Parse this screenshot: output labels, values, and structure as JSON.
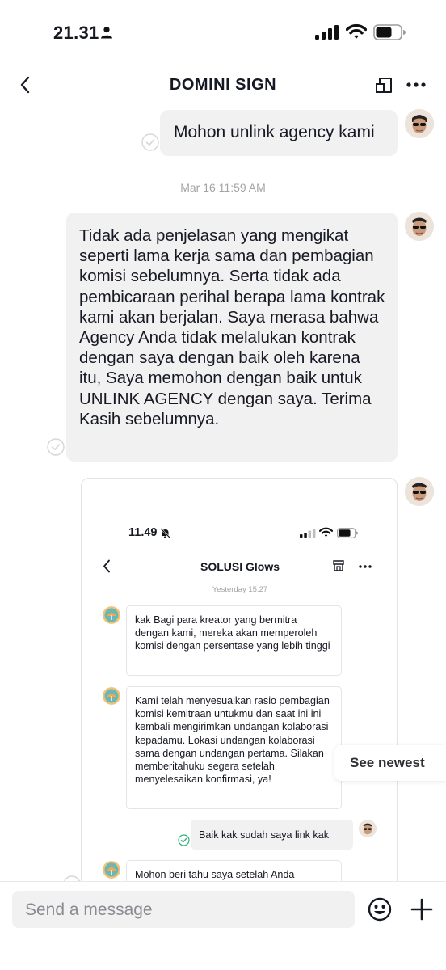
{
  "status_bar": {
    "time": "21.31"
  },
  "header": {
    "title": "DOMINI SIGN"
  },
  "messages": [
    {
      "text": "Mohon unlink agency kami"
    },
    {
      "text": "Tidak ada penjelasan yang mengikat seperti lama kerja sama dan pembagian komisi sebelumnya. Serta tidak ada pembicaraan perihal berapa lama kontrak kami akan berjalan. Saya merasa bahwa Agency Anda tidak melalukan kontrak dengan saya dengan baik oleh karena itu, Saya memohon dengan baik untuk UNLINK AGENCY dengan saya. Terima Kasih sebelumnya."
    }
  ],
  "timestamp": "Mar 16 11:59 AM",
  "image_message": {
    "status_time": "11.49",
    "chat_title": "SOLUSI Glows",
    "timestamp": "Yesterday 15:27",
    "messages": [
      {
        "text": "kak Bagi para kreator yang bermitra dengan kami, mereka akan memperoleh komisi dengan persentase yang lebih tinggi"
      },
      {
        "text": "Kami telah menyesuaikan rasio pembagian komisi kemitraan untukmu dan saat ini ini kembali mengirimkan undangan kolaborasi kepadamu. Lokasi undangan kolaborasi sama dengan undangan pertama. Silakan memberitahuku segera setelah menyelesaikan konfirmasi, ya!"
      },
      {
        "text": "Baik kak sudah saya link kak"
      },
      {
        "text": "Mohon beri tahu saya setelah Anda"
      }
    ]
  },
  "see_newest": "See newest",
  "composer": {
    "placeholder": "Send a message"
  },
  "icons": {
    "back": "chevron-left-icon",
    "report": "report-icon",
    "more": "more-icon",
    "emoji": "emoji-icon",
    "plus": "plus-icon"
  }
}
